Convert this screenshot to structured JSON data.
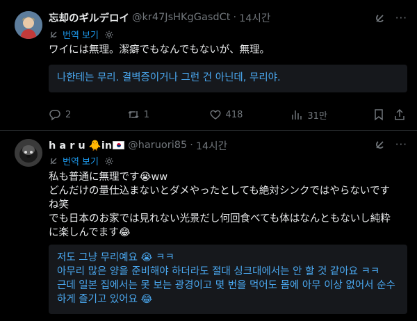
{
  "tweet1": {
    "name": "忘却のギルデロイ",
    "handle": "@kr47JsHKgGasdCt",
    "dot": "·",
    "time": "14시간",
    "translate_label": "번역 보기",
    "text": "ワイには無理。潔癖でもなんでもないが、無理。",
    "translation": "나한테는 무리. 결벽증이거나 그런 건 아닌데, 무리야.",
    "replies": "2",
    "retweets": "1",
    "likes": "418",
    "views": "31만"
  },
  "tweet2": {
    "name": "h a r u",
    "name_suffix": "in",
    "handle": "@haruori85",
    "dot": "·",
    "time": "14시간",
    "translate_label": "번역 보기",
    "text_lines": [
      "私も普通に無理です😭ww",
      "どんだけの量仕込まないとダメやったとしても絶対シンクではやらないです",
      "ね笑",
      "でも日本のお家では見れない光景だし何回食べても体はなんともないし純粋",
      "に楽しんでます😂"
    ],
    "translation_lines": [
      "저도 그냥 무리예요 😭 ㅋㅋ",
      "아무리 많은 양을 준비해야 하더라도 절대 싱크대에서는 안 할 것 같아요 ㅋㅋ",
      "근데 일본 집에서는 못 보는 광경이고 몇 번을 먹어도 몸에 아무 이상 없어서 순수",
      "하게 즐기고 있어요 😂"
    ]
  },
  "icons": {
    "grok": "grok-icon",
    "more": "more-icon",
    "translate": "translate-icon",
    "gear": "gear-icon",
    "reply": "reply-icon",
    "retweet": "retweet-icon",
    "like": "heart-icon",
    "views": "views-icon",
    "bookmark": "bookmark-icon",
    "share": "share-icon"
  },
  "colors": {
    "background": "#000000",
    "text": "#e7e9ea",
    "muted": "#71767b",
    "link": "#1d9bf0",
    "translation": "#4aa8f0",
    "box": "#16181c"
  }
}
